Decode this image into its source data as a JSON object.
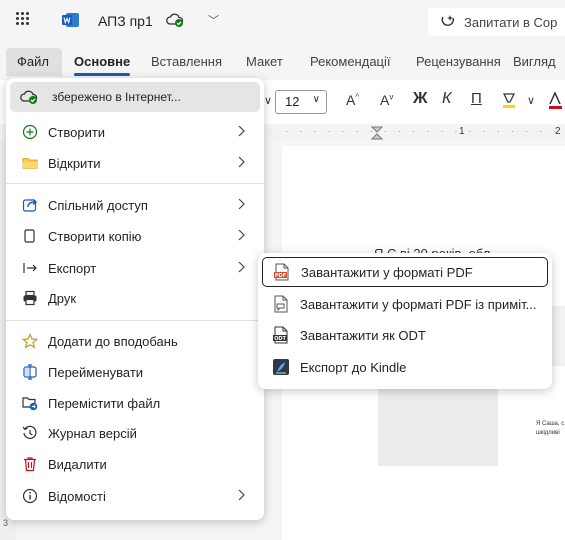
{
  "titlebar": {
    "doc_title": "АПЗ пр1",
    "ask_placeholder": "Запитати в Cop"
  },
  "ribbon": {
    "tabs": [
      "Файл",
      "Основне",
      "Вставлення",
      "Макет",
      "Рекомендації",
      "Рецензування",
      "Вигляд"
    ],
    "font_size": "12"
  },
  "ruler": {
    "mark": "1",
    "mark2": "2"
  },
  "document": {
    "visible_line": "Я С                  ві 20 років, обл",
    "thumb_text_1": "Я Саша, с",
    "thumb_text_2": "шкідливі",
    "page_number": "3"
  },
  "file_menu": {
    "status": "збережено в Інтернет...",
    "items": [
      {
        "label": "Створити",
        "icon": "plus-circle-icon",
        "submenu": true
      },
      {
        "label": "Відкрити",
        "icon": "folder-icon",
        "submenu": true
      },
      {
        "label": "Спільний доступ",
        "icon": "share-icon",
        "submenu": true
      },
      {
        "label": "Створити копію",
        "icon": "copy-icon",
        "submenu": true
      },
      {
        "label": "Експорт",
        "icon": "export-icon",
        "submenu": true
      },
      {
        "label": "Друк",
        "icon": "printer-icon",
        "submenu": false
      },
      {
        "label": "Додати до вподобань",
        "icon": "star-icon",
        "submenu": false
      },
      {
        "label": "Перейменувати",
        "icon": "rename-icon",
        "submenu": false
      },
      {
        "label": "Перемістити файл",
        "icon": "move-file-icon",
        "submenu": false
      },
      {
        "label": "Журнал версій",
        "icon": "history-icon",
        "submenu": false
      },
      {
        "label": "Видалити",
        "icon": "trash-icon",
        "submenu": false
      },
      {
        "label": "Відомості",
        "icon": "info-icon",
        "submenu": true
      }
    ]
  },
  "export_menu": {
    "items": [
      {
        "label": "Завантажити у форматі PDF",
        "icon": "pdf-icon",
        "selected": true
      },
      {
        "label": "Завантажити у форматі PDF із приміт...",
        "icon": "pdf-comments-icon",
        "selected": false
      },
      {
        "label": "Завантажити як ODT",
        "icon": "odt-icon",
        "selected": false
      },
      {
        "label": "Експорт до Kindle",
        "icon": "kindle-icon",
        "selected": false
      }
    ]
  },
  "colors": {
    "accent": "#185abd",
    "saved_green": "#107c10",
    "trash_red": "#c50f1f",
    "pdf_orange": "#d35230",
    "kindle_dark": "#2b3a4a"
  }
}
